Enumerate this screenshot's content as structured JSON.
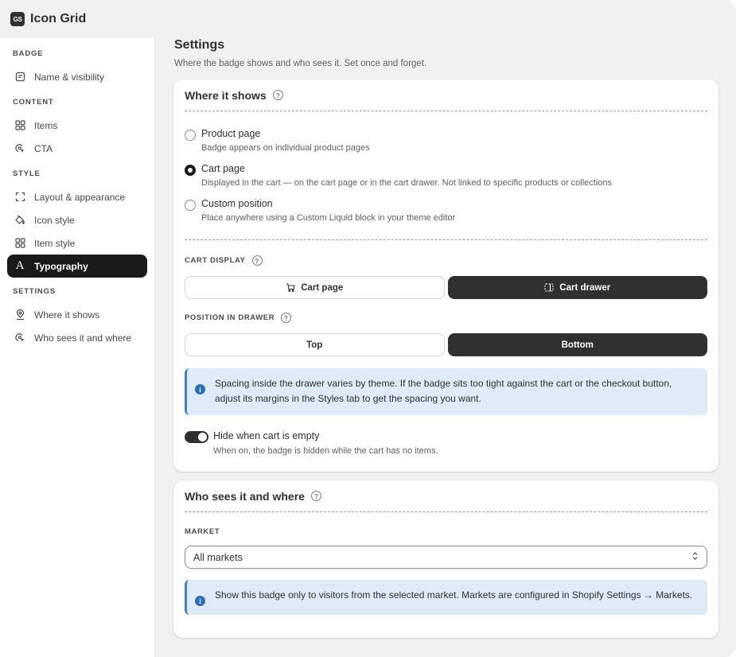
{
  "app": {
    "logo_text": "GS",
    "title": "Icon Grid"
  },
  "sidebar": {
    "sections": [
      {
        "heading": "BADGE",
        "items": [
          {
            "label": "Name & visibility",
            "icon": "note-icon"
          }
        ]
      },
      {
        "heading": "CONTENT",
        "items": [
          {
            "label": "Items",
            "icon": "grid-icon"
          },
          {
            "label": "CTA",
            "icon": "cursor-target-icon"
          }
        ]
      },
      {
        "heading": "STYLE",
        "items": [
          {
            "label": "Layout & appearance",
            "icon": "frame-icon"
          },
          {
            "label": "Icon style",
            "icon": "paint-bucket-icon"
          },
          {
            "label": "Item style",
            "icon": "grid-icon"
          },
          {
            "label": "Typography",
            "icon": "typography-icon",
            "icon_glyph": "A",
            "active": true
          }
        ]
      },
      {
        "heading": "SETTINGS",
        "items": [
          {
            "label": "Where it shows",
            "icon": "location-pin-icon"
          },
          {
            "label": "Who sees it and where",
            "icon": "cursor-target-icon"
          }
        ]
      }
    ]
  },
  "page": {
    "title": "Settings",
    "subtitle": "Where the badge shows and who sees it. Set once and forget."
  },
  "where_card": {
    "title": "Where it shows",
    "options": [
      {
        "label": "Product page",
        "help": "Badge appears on individual product pages",
        "checked": false
      },
      {
        "label": "Cart page",
        "help": "Displayed in the cart — on the cart page or in the cart drawer. Not linked to specific products or collections",
        "checked": true
      },
      {
        "label": "Custom position",
        "help": "Place anywhere using a Custom Liquid block in your theme editor",
        "checked": false
      }
    ],
    "cart_display": {
      "heading": "CART DISPLAY",
      "options": [
        "Cart page",
        "Cart drawer"
      ],
      "selected": "Cart drawer"
    },
    "position": {
      "heading": "POSITION IN DRAWER",
      "options": [
        "Top",
        "Bottom"
      ],
      "selected": "Bottom"
    },
    "banner": "Spacing inside the drawer varies by theme. If the badge sits too tight against the cart or the checkout button, adjust its margins in the Styles tab to get the spacing you want.",
    "toggle": {
      "label": "Hide when cart is empty",
      "help": "When on, the badge is hidden while the cart has no items.",
      "on": true
    }
  },
  "who_card": {
    "title": "Who sees it and where",
    "market_heading": "MARKET",
    "market_value": "All markets",
    "banner": "Show this badge only to visitors from the selected market. Markets are configured in Shopify Settings → Markets."
  },
  "colors": {
    "accent_dark": "#303030",
    "banner_bg": "#e0ebf8",
    "info_blue": "#2e6cb5"
  }
}
